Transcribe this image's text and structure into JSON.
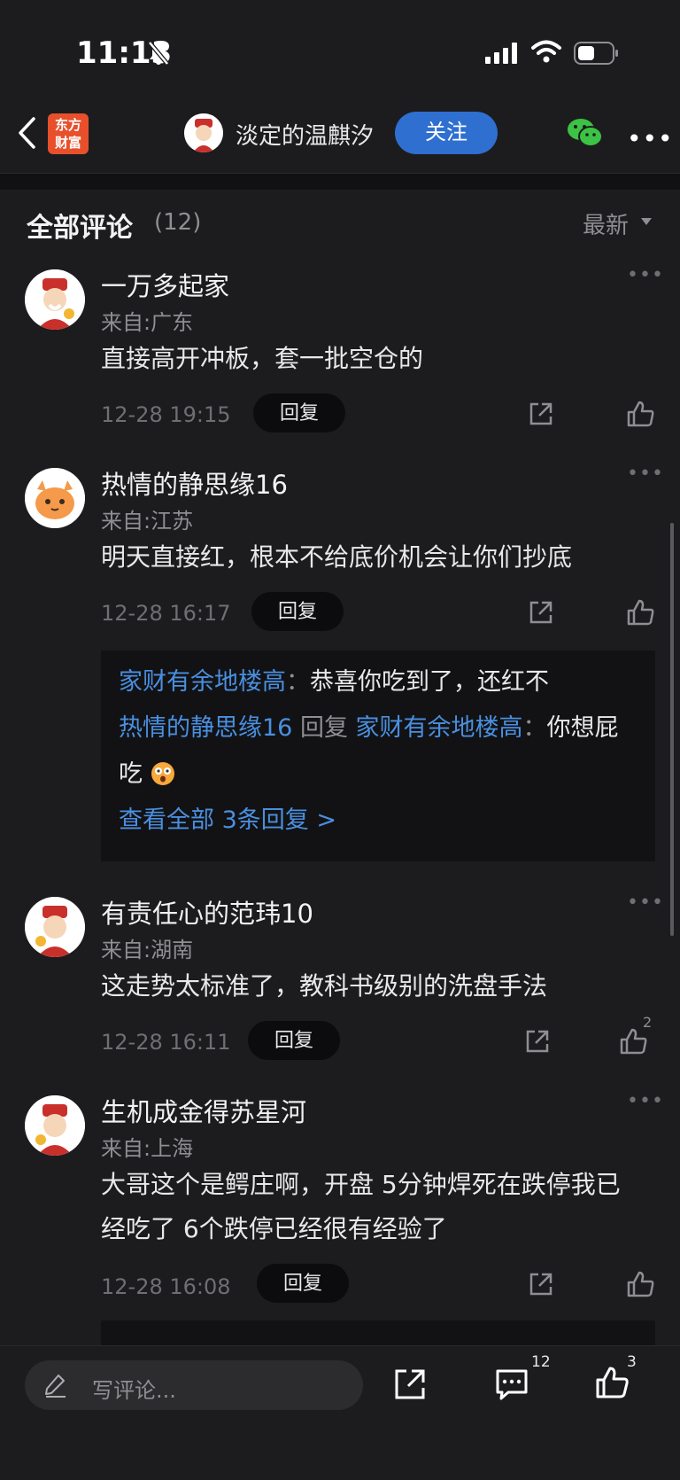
{
  "status_bar": {
    "time": "11:13"
  },
  "nav": {
    "logo_line1": "东方",
    "logo_line2": "财富",
    "user_name": "淡定的温麒汐",
    "follow_label": "关注"
  },
  "section": {
    "title": "全部评论",
    "count": "(12)",
    "sort_label": "最新"
  },
  "comments": [
    {
      "name": "一万多起家",
      "location": "来自:广东",
      "body": "直接高开冲板，套一批空仓的",
      "time": "12-28 19:15",
      "reply_label": "回复",
      "likes": ""
    },
    {
      "name": "热情的静思缘16",
      "location": "来自:江苏",
      "body": "明天直接红，根本不给底价机会让你们抄底",
      "time": "12-28 16:17",
      "reply_label": "回复",
      "likes": "",
      "replies": {
        "r1_user": "家财有余地楼高",
        "r1_sep": "：",
        "r1_text": "恭喜你吃到了，还红不",
        "r2_user": "热情的静思缘16",
        "r2_mid": " 回复 ",
        "r2_target": "家财有余地楼高",
        "r2_sep": "：",
        "r2_text": "你想屁吃",
        "view_all": "查看全部 3条回复 >"
      }
    },
    {
      "name": "有责任心的范玮10",
      "location": "来自:湖南",
      "body": "这走势太标准了，教科书级别的洗盘手法",
      "time": "12-28 16:11",
      "reply_label": "回复",
      "likes": "2"
    },
    {
      "name": "生机成金得苏星河",
      "location": "来自:上海",
      "body": "大哥这个是鳄庄啊，开盘 5分钟焊死在跌停我已经吃了 6个跌停已经很有经验了",
      "time": "12-28 16:08",
      "reply_label": "回复",
      "likes": ""
    }
  ],
  "bottom_bar": {
    "input_placeholder": "写评论...",
    "comment_count": "12",
    "like_count": "3"
  }
}
